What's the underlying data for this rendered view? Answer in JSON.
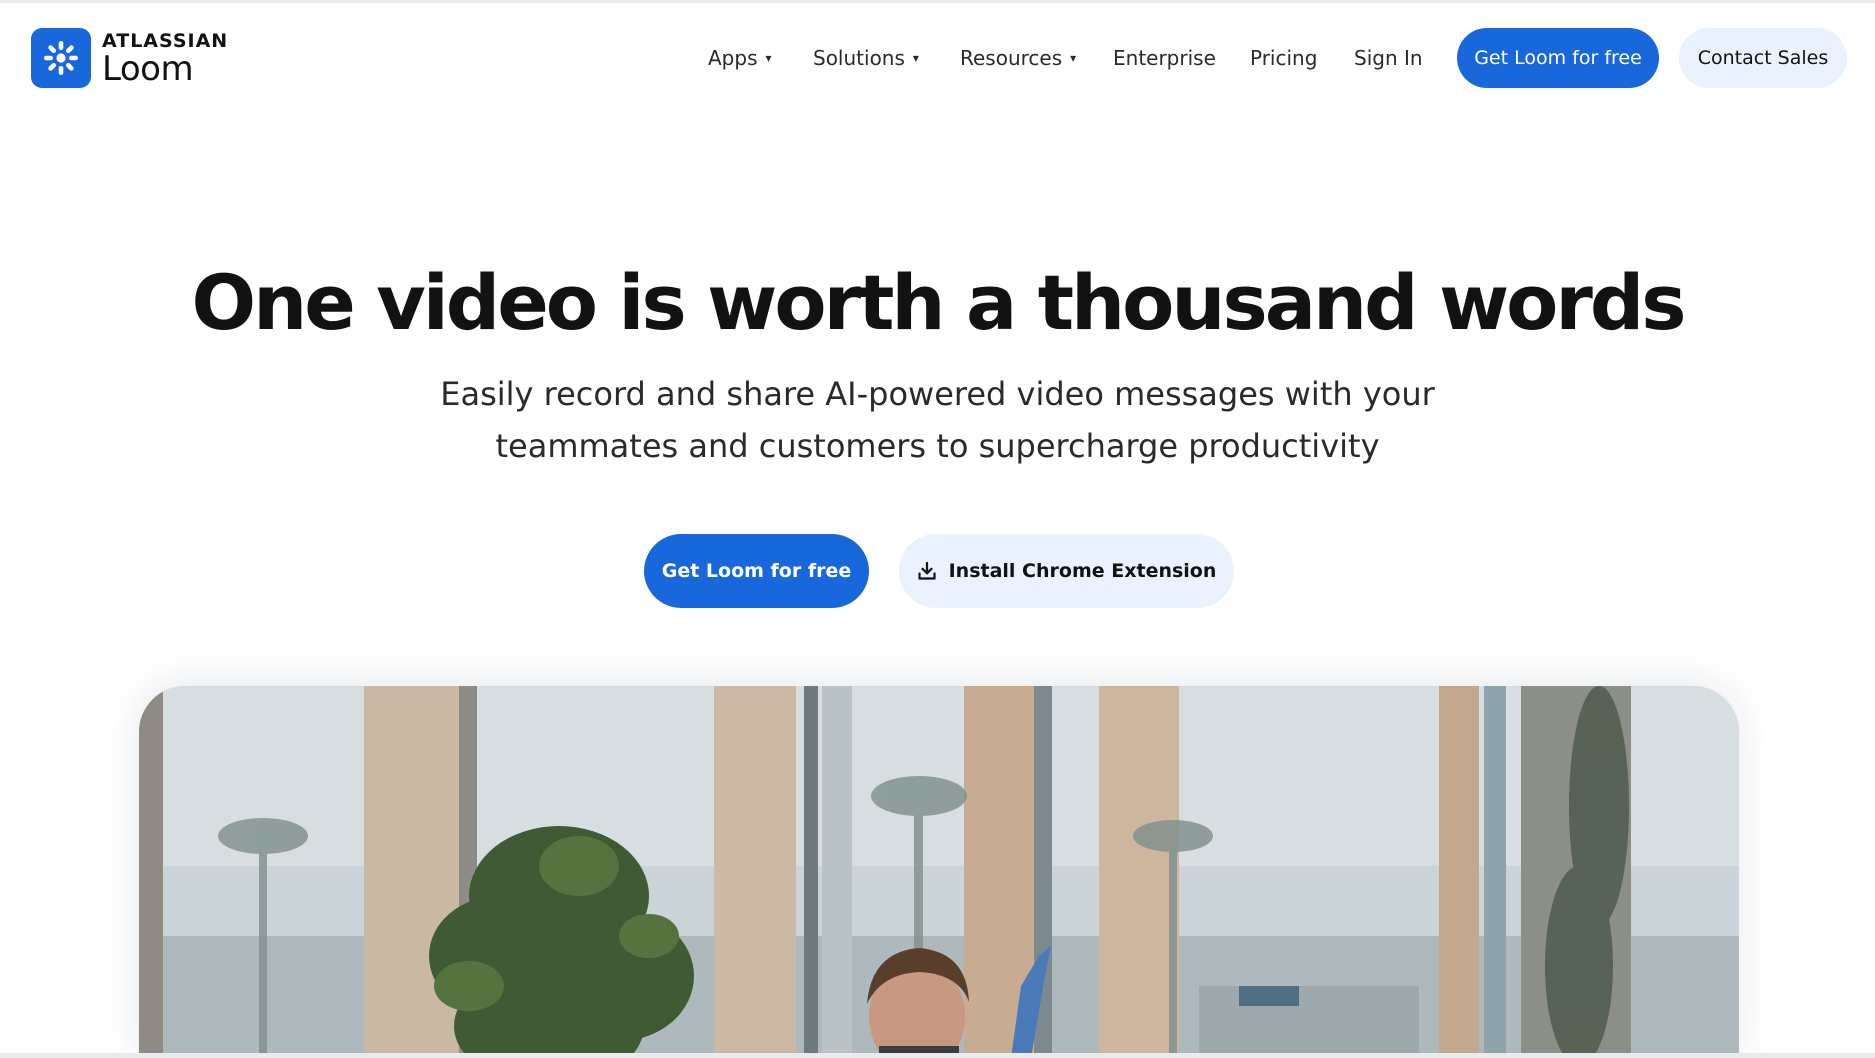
{
  "brand": {
    "company": "ATLASSIAN",
    "product": "Loom",
    "logo_icon": "loom-asterisk-icon",
    "accent_color": "#1868db"
  },
  "nav": {
    "items": [
      {
        "label": "Apps",
        "has_dropdown": true
      },
      {
        "label": "Solutions",
        "has_dropdown": true
      },
      {
        "label": "Resources",
        "has_dropdown": true
      },
      {
        "label": "Enterprise",
        "has_dropdown": false
      },
      {
        "label": "Pricing",
        "has_dropdown": false
      },
      {
        "label": "Sign In",
        "has_dropdown": false
      }
    ],
    "caret": "▾",
    "cta_primary": "Get Loom for free",
    "cta_secondary": "Contact Sales"
  },
  "hero": {
    "title": "One video is worth a thousand words",
    "subtitle_line1": "Easily record and share AI-powered video messages with your",
    "subtitle_line2": "teammates and customers to supercharge productivity",
    "cta_primary": "Get Loom for free",
    "cta_secondary": "Install Chrome Extension",
    "cta_secondary_icon": "download-icon"
  }
}
